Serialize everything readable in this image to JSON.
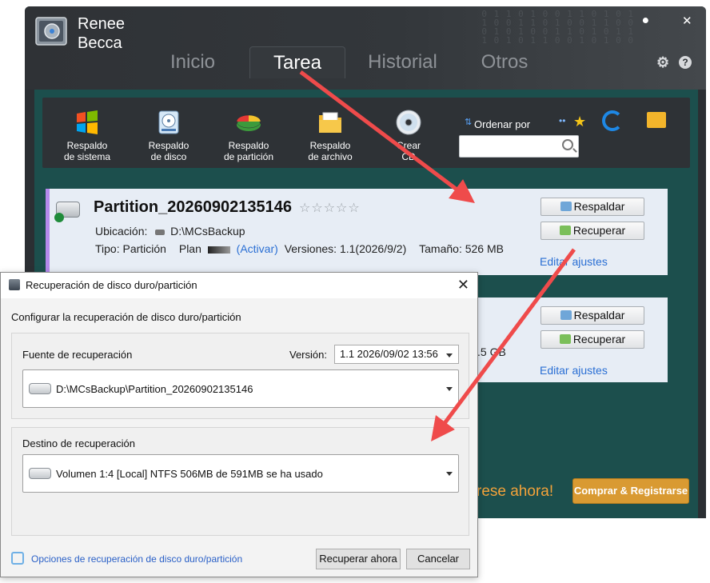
{
  "app": {
    "brand_line1": "Renee",
    "brand_line2": "Becca",
    "tabs": [
      {
        "label": "Inicio",
        "active": false
      },
      {
        "label": "Tarea",
        "active": true
      },
      {
        "label": "Historial",
        "active": false
      },
      {
        "label": "Otros",
        "active": false
      }
    ],
    "toolbar": {
      "tools": [
        {
          "label1": "Respaldo",
          "label2": "de sistema",
          "icon": "windows-flag-icon"
        },
        {
          "label1": "Respaldo",
          "label2": "de disco",
          "icon": "hard-disk-icon"
        },
        {
          "label1": "Respaldo",
          "label2": "de partición",
          "icon": "pie-partition-icon"
        },
        {
          "label1": "Respaldo",
          "label2": "de archivo",
          "icon": "folder-icon"
        },
        {
          "label1": "Crear",
          "label2": "CD",
          "icon": "cd-icon"
        }
      ],
      "sort_label": "Ordenar por",
      "search_placeholder": ""
    },
    "tasks": [
      {
        "title": "Partition_20260902135146",
        "location_label": "Ubicación:",
        "location_value": "D:\\MCsBackup",
        "type_label": "Tipo:",
        "type_value": "Partición",
        "plan_label": "Plan",
        "activate_label": "(Activar)",
        "versions_label": "Versiones:",
        "versions_value": "1.1(2026/9/2)",
        "size_label": "Tamaño:",
        "size_value": "526 MB",
        "backup_btn": "Respaldar",
        "restore_btn": "Recuperar",
        "edit_link": "Editar ajustes"
      },
      {
        "size_fragment": ".5 GB",
        "backup_btn": "Respaldar",
        "restore_btn": "Recuperar",
        "edit_link": "Editar ajustes"
      }
    ],
    "promo_text": "rese ahora!",
    "buy_button": "Comprar & Registrarse"
  },
  "dialog": {
    "title": "Recuperación de disco duro/partición",
    "heading": "Configurar la recuperación de disco duro/partición",
    "source_label": "Fuente de recuperación",
    "version_label": "Versión:",
    "version_value": "1.1  2026/09/02 13:56",
    "source_path": "D:\\MCsBackup\\Partition_20260902135146",
    "dest_label": "Destino de recuperación",
    "dest_value": "Volumen 1:4 [Local] NTFS   506MB de 591MB se ha usado",
    "options_link": "Opciones de recuperación de disco duro/partición",
    "restore_now_btn": "Recuperar ahora",
    "cancel_btn": "Cancelar"
  },
  "colors": {
    "accent_blue": "#2a6fd4",
    "teal_bg": "#1c4f4d",
    "annotation_red": "#ef4b4b",
    "buy_orange": "#d99a32"
  }
}
